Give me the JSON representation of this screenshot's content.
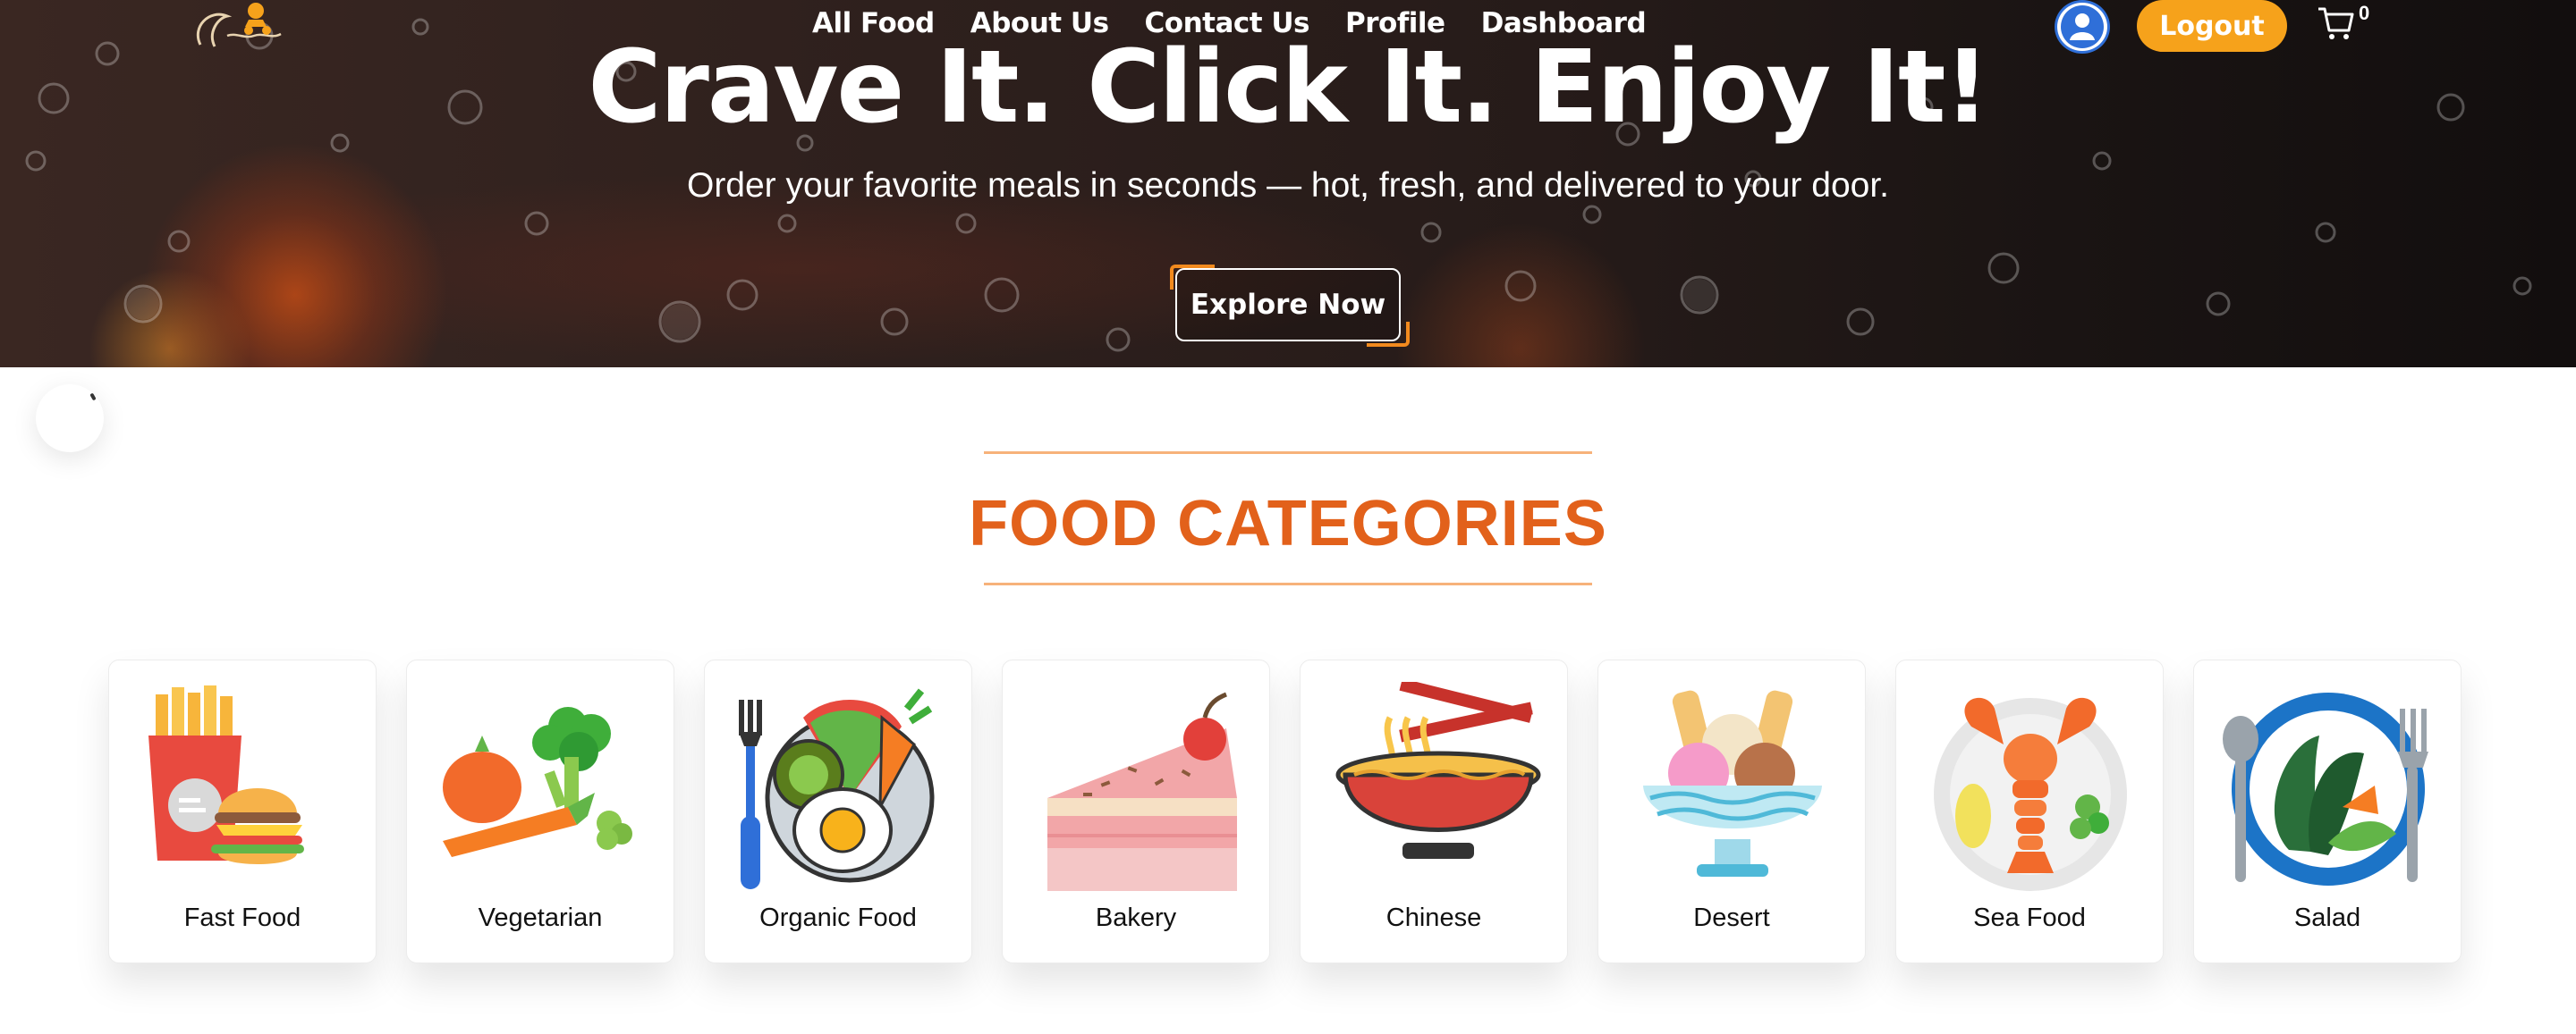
{
  "nav": {
    "links": [
      "All Food",
      "About Us",
      "Contact Us",
      "Profile",
      "Dashboard"
    ],
    "logout_label": "Logout",
    "cart_count": "0"
  },
  "hero": {
    "headline": "Crave It. Click It. Enjoy It!",
    "subhead": "Order your favorite meals in seconds — hot, fresh, and delivered to your door.",
    "cta_label": "Explore Now"
  },
  "categories": {
    "title": "FOOD CATEGORIES",
    "items": [
      {
        "label": "Fast Food",
        "icon": "fast-food-icon"
      },
      {
        "label": "Vegetarian",
        "icon": "vegetables-icon"
      },
      {
        "label": "Organic Food",
        "icon": "organic-plate-icon"
      },
      {
        "label": "Bakery",
        "icon": "cake-slice-icon"
      },
      {
        "label": "Chinese",
        "icon": "noodle-bowl-icon"
      },
      {
        "label": "Desert",
        "icon": "ice-cream-bowl-icon"
      },
      {
        "label": "Sea Food",
        "icon": "lobster-plate-icon"
      },
      {
        "label": "Salad",
        "icon": "salad-plate-icon"
      }
    ]
  },
  "colors": {
    "accent_orange": "#f6a21b",
    "title_orange": "#e2611b",
    "avatar_blue": "#2f6fd8"
  }
}
